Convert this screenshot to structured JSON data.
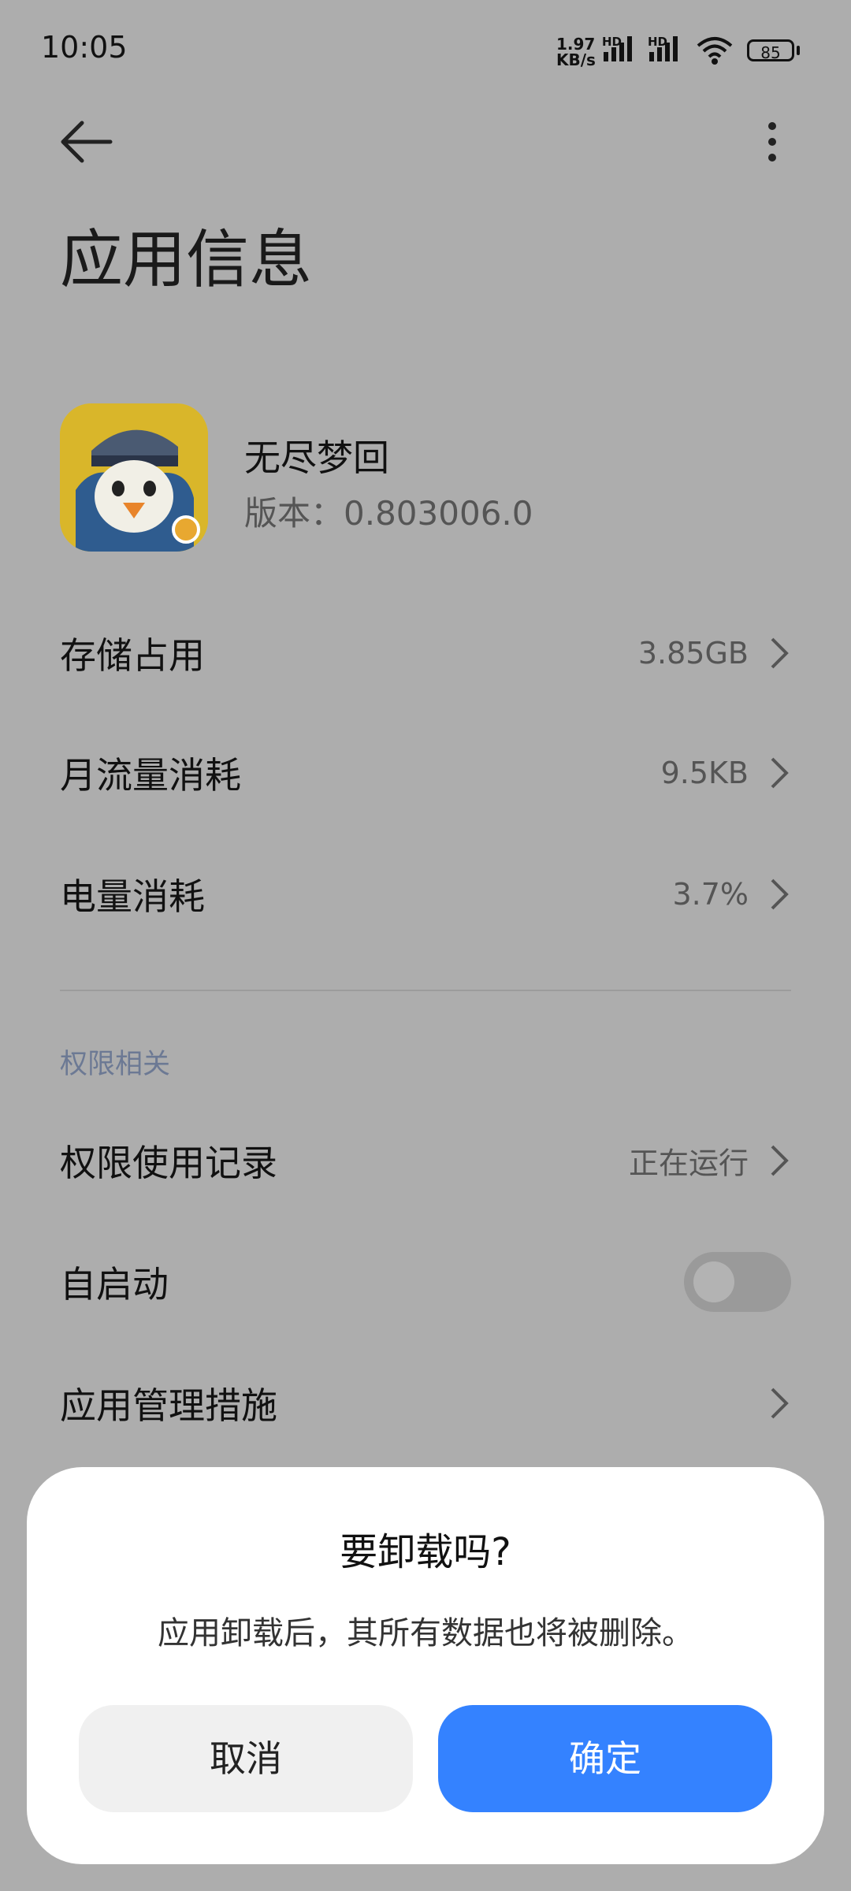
{
  "status_bar": {
    "time": "10:05",
    "net_speed_value": "1.97",
    "net_speed_unit": "KB/s",
    "hd_label": "HD",
    "battery": "85",
    "icons": [
      "signal-icon",
      "wifi-icon",
      "battery-icon"
    ]
  },
  "toolbar": {
    "back_icon": "arrow-left-icon",
    "more_icon": "more-vertical-icon"
  },
  "page": {
    "title": "应用信息"
  },
  "app": {
    "name": "无尽梦回",
    "version_label": "版本：",
    "version_value": "0.803006.0"
  },
  "rows": [
    {
      "label": "存储占用",
      "value": "3.85GB"
    },
    {
      "label": "月流量消耗",
      "value": "9.5KB"
    },
    {
      "label": "电量消耗",
      "value": "3.7%"
    }
  ],
  "permissions": {
    "section_title": "权限相关",
    "record_label": "权限使用记录",
    "record_value": "正在运行",
    "autostart_label": "自启动",
    "autostart_on": false,
    "manage_label": "应用管理措施"
  },
  "dialog": {
    "title": "要卸载吗?",
    "message": "应用卸载后，其所有数据也将被删除。",
    "cancel_label": "取消",
    "confirm_label": "确定",
    "confirm_color": "#3482ff"
  },
  "colors": {
    "dimmed_background": "#adadad",
    "section_header": "#6c7994"
  }
}
